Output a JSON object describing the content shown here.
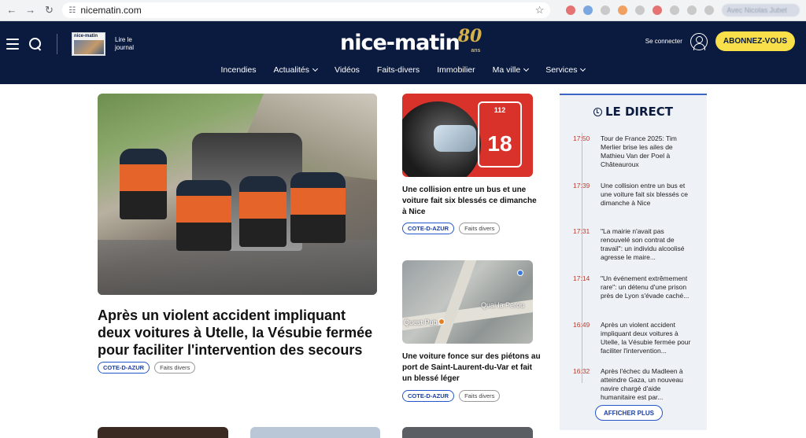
{
  "browser": {
    "url": "nicematin.com",
    "profile_text": "Avec Nicolas Jubet"
  },
  "header": {
    "journal_thumb_title": "nice-matin",
    "lire_line1": "Lire le",
    "lire_line2": "journal",
    "logo_text": "nice-matin",
    "logo_anni": "80",
    "logo_ans": "ans",
    "login_label": "Se connecter",
    "subscribe_label": "ABONNEZ-VOUS"
  },
  "nav": {
    "items": [
      {
        "label": "Incendies"
      },
      {
        "label": "Actualités"
      },
      {
        "label": "Vidéos"
      },
      {
        "label": "Faits-divers"
      },
      {
        "label": "Immobilier"
      },
      {
        "label": "Ma ville"
      },
      {
        "label": "Services"
      }
    ]
  },
  "hero": {
    "title": "Après un violent accident impliquant deux voitures à Utelle, la Vésubie fermée pour faciliter l'intervention des secours",
    "tag_region": "COTE-D-AZUR",
    "tag_section": "Faits divers"
  },
  "side_articles": [
    {
      "badge_top": "112",
      "badge_number": "18",
      "title": "Une collision entre un bus et une voiture fait six blessés ce dimanche à Nice",
      "tag_region": "COTE-D-AZUR",
      "tag_section": "Faits divers"
    },
    {
      "map_label1": "Quai la Perou",
      "map_label2": "Quest Pub",
      "title": "Une voiture fonce sur des piétons au port de Saint-Laurent-du-Var et fait un blessé léger",
      "tag_region": "COTE-D-AZUR",
      "tag_section": "Faits divers"
    }
  ],
  "direct": {
    "title": "LE DIRECT",
    "entries": [
      {
        "time": "17:50",
        "text": "Tour de France 2025: Tim Merlier brise les ailes de Mathieu Van der Poel à Châteauroux"
      },
      {
        "time": "17:39",
        "text": "Une collision entre un bus et une voiture fait six blessés ce dimanche à Nice"
      },
      {
        "time": "17:31",
        "text": "\"La mairie n'avait pas renouvelé son contrat de travail\": un individu alcoolisé agresse le maire..."
      },
      {
        "time": "17:14",
        "text": "\"Un événement extrêmement rare\": un détenu d'une prison près de Lyon s'évade caché..."
      },
      {
        "time": "16:49",
        "text": "Après un violent accident impliquant deux voitures à Utelle, la Vésubie fermée pour faciliter l'intervention..."
      },
      {
        "time": "16:32",
        "text": "Après l'échec du Madleen à atteindre Gaza, un nouveau navire chargé d'aide humanitaire est par..."
      }
    ],
    "more_label": "AFFICHER PLUS"
  }
}
